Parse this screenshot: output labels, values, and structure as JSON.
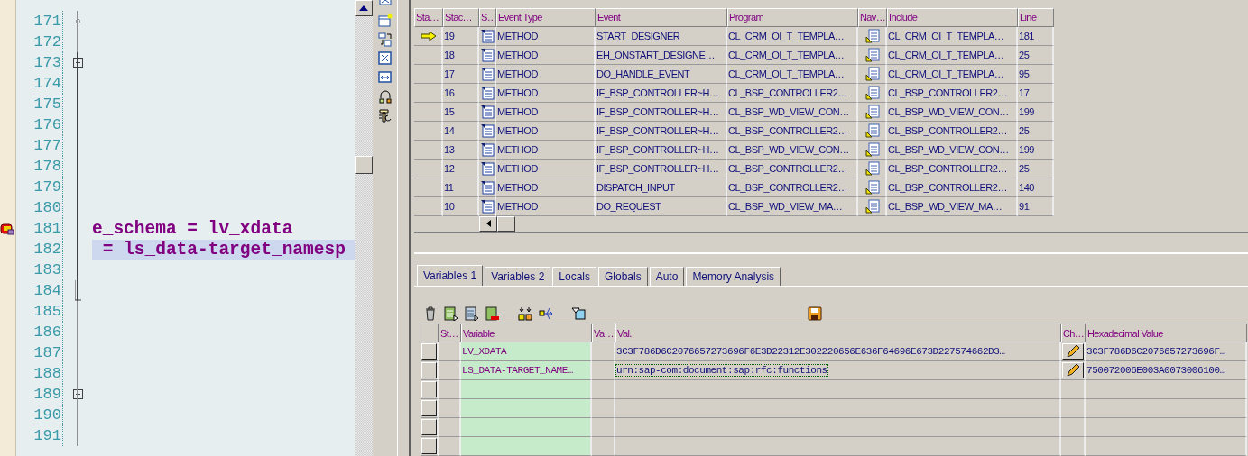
{
  "editor": {
    "lines": [
      {
        "number": "171",
        "kind": "branch",
        "current": false,
        "highlighted": false
      },
      {
        "number": "172",
        "kind": "plain",
        "current": false,
        "highlighted": false
      },
      {
        "number": "173",
        "kind": "fold",
        "current": false,
        "highlighted": false
      },
      {
        "number": "174",
        "kind": "plain",
        "current": false,
        "highlighted": false
      },
      {
        "number": "175",
        "kind": "plain",
        "current": false,
        "highlighted": false
      },
      {
        "number": "176",
        "kind": "plain",
        "current": false,
        "highlighted": false
      },
      {
        "number": "177",
        "kind": "plain",
        "current": false,
        "highlighted": false
      },
      {
        "number": "178",
        "kind": "plain",
        "current": false,
        "highlighted": false
      },
      {
        "number": "179",
        "kind": "plain",
        "current": false,
        "highlighted": false
      },
      {
        "number": "180",
        "kind": "plain",
        "current": false,
        "highlighted": false
      },
      {
        "number": "181",
        "kind": "plain",
        "current": true,
        "highlighted": false,
        "code": "e_schema = lv_xdata"
      },
      {
        "number": "182",
        "kind": "plain",
        "current": false,
        "highlighted": true,
        "code": " = ls_data-target_namesp"
      },
      {
        "number": "183",
        "kind": "plain",
        "current": false,
        "highlighted": false
      },
      {
        "number": "184",
        "kind": "end",
        "current": false,
        "highlighted": false
      },
      {
        "number": "185",
        "kind": "plain",
        "current": false,
        "highlighted": false
      },
      {
        "number": "186",
        "kind": "plain",
        "current": false,
        "highlighted": false
      },
      {
        "number": "187",
        "kind": "plain",
        "current": false,
        "highlighted": false
      },
      {
        "number": "188",
        "kind": "plain",
        "current": false,
        "highlighted": false
      },
      {
        "number": "189",
        "kind": "fold",
        "current": false,
        "highlighted": false
      },
      {
        "number": "190",
        "kind": "plain",
        "current": false,
        "highlighted": false
      },
      {
        "number": "191",
        "kind": "plain",
        "current": false,
        "highlighted": false
      }
    ]
  },
  "stack": {
    "columns": [
      "Sta…",
      "Stac…",
      "S…",
      "Event Type",
      "Event",
      "Program",
      "Nav…",
      "Include",
      "Line"
    ],
    "rows": [
      {
        "current": true,
        "depth": "19",
        "event_type": "METHOD",
        "event": "START_DESIGNER",
        "program": "CL_CRM_OI_T_TEMPLA…",
        "include": "CL_CRM_OI_T_TEMPLA…",
        "line": "181"
      },
      {
        "current": false,
        "depth": "18",
        "event_type": "METHOD",
        "event": "EH_ONSTART_DESIGNE…",
        "program": "CL_CRM_OI_T_TEMPLA…",
        "include": "CL_CRM_OI_T_TEMPLA…",
        "line": "25"
      },
      {
        "current": false,
        "depth": "17",
        "event_type": "METHOD",
        "event": "DO_HANDLE_EVENT",
        "program": "CL_CRM_OI_T_TEMPLA…",
        "include": "CL_CRM_OI_T_TEMPLA…",
        "line": "95"
      },
      {
        "current": false,
        "depth": "16",
        "event_type": "METHOD",
        "event": "IF_BSP_CONTROLLER~H…",
        "program": "CL_BSP_CONTROLLER2…",
        "include": "CL_BSP_CONTROLLER2…",
        "line": "17"
      },
      {
        "current": false,
        "depth": "15",
        "event_type": "METHOD",
        "event": "IF_BSP_CONTROLLER~H…",
        "program": "CL_BSP_WD_VIEW_CON…",
        "include": "CL_BSP_WD_VIEW_CON…",
        "line": "199"
      },
      {
        "current": false,
        "depth": "14",
        "event_type": "METHOD",
        "event": "IF_BSP_CONTROLLER~H…",
        "program": "CL_BSP_CONTROLLER2…",
        "include": "CL_BSP_CONTROLLER2…",
        "line": "25"
      },
      {
        "current": false,
        "depth": "13",
        "event_type": "METHOD",
        "event": "IF_BSP_CONTROLLER~H…",
        "program": "CL_BSP_WD_VIEW_CON…",
        "include": "CL_BSP_WD_VIEW_CON…",
        "line": "199"
      },
      {
        "current": false,
        "depth": "12",
        "event_type": "METHOD",
        "event": "IF_BSP_CONTROLLER~H…",
        "program": "CL_BSP_CONTROLLER2…",
        "include": "CL_BSP_CONTROLLER2…",
        "line": "25"
      },
      {
        "current": false,
        "depth": "11",
        "event_type": "METHOD",
        "event": "DISPATCH_INPUT",
        "program": "CL_BSP_CONTROLLER2…",
        "include": "CL_BSP_CONTROLLER2…",
        "line": "140"
      },
      {
        "current": false,
        "depth": "10",
        "event_type": "METHOD",
        "event": "DO_REQUEST",
        "program": "CL_BSP_WD_VIEW_MA…",
        "include": "CL_BSP_WD_VIEW_MA…",
        "line": "91"
      }
    ]
  },
  "variables": {
    "tabs": [
      {
        "label": "Variables 1",
        "selected": true
      },
      {
        "label": "Variables 2",
        "selected": false
      },
      {
        "label": "Locals",
        "selected": false
      },
      {
        "label": "Globals",
        "selected": false
      },
      {
        "label": "Auto",
        "selected": false
      },
      {
        "label": "Memory Analysis",
        "selected": false
      }
    ],
    "columns": [
      "St…",
      "Variable",
      "Va…",
      "Val.",
      "Ch…",
      "Hexadecimal Value"
    ],
    "rows": [
      {
        "variable": "LV_XDATA",
        "value": "3C3F786D6C2076657273696F6E3D22312E302220656E636F64696E673D227574662D3…",
        "hex": "3C3F786D6C2076657273696F…",
        "focused": false
      },
      {
        "variable": "LS_DATA-TARGET_NAME…",
        "value": "urn:sap-com:document:sap:rfc:functions",
        "hex": "750072006E003A0073006100…",
        "focused": true
      }
    ]
  }
}
